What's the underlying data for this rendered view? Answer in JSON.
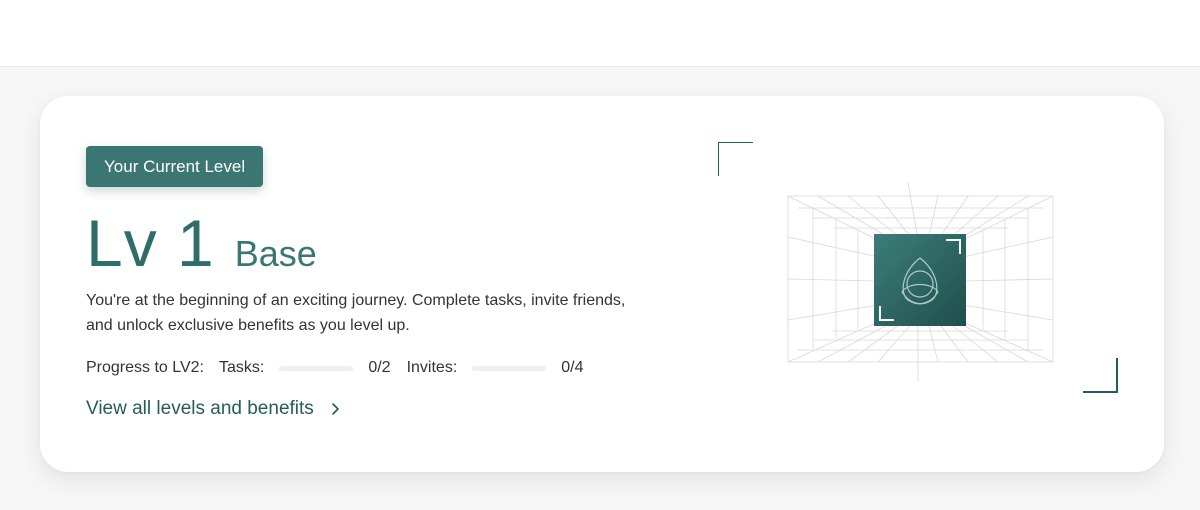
{
  "level_card": {
    "badge": "Your Current Level",
    "level_number": "Lv 1",
    "level_name": "Base",
    "description": "You're at the beginning of an exciting journey. Complete tasks, invite friends, and unlock exclusive benefits as you level up.",
    "progress": {
      "label": "Progress to LV2:",
      "tasks": {
        "label": "Tasks:",
        "count": "0/2",
        "fraction": 0
      },
      "invites": {
        "label": "Invites:",
        "count": "0/4",
        "fraction": 0
      }
    },
    "view_link": "View all levels and benefits",
    "icons": {
      "link_chevron": "chevron-right-icon",
      "level_emblem": "triquetra-icon"
    }
  },
  "colors": {
    "accent": "#3b7672",
    "accent_dark": "#255d5a",
    "card_bg": "#ffffff",
    "page_bg": "#f6f6f6"
  }
}
